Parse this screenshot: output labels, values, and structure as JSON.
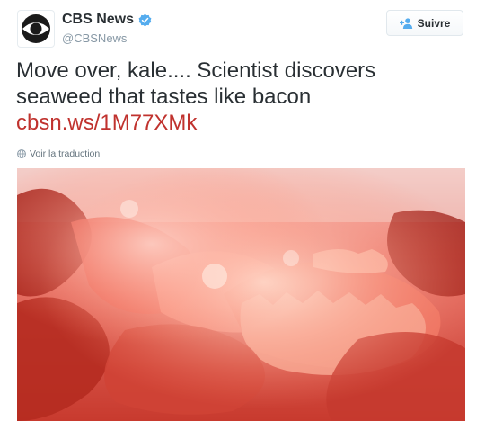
{
  "header": {
    "name": "CBS News",
    "handle": "@CBSNews",
    "follow_label": "Suivre"
  },
  "tweet": {
    "text": "Move over, kale.... Scientist discovers seaweed that tastes like bacon",
    "link": "cbsn.ws/1M77XMk"
  },
  "translate_label": "Voir la traduction",
  "colors": {
    "link": "#c0322e",
    "verified": "#55acee",
    "text": "#292f33",
    "secondary": "#8899a6"
  },
  "icons": {
    "avatar": "cbs-eye-logo",
    "verified": "verified-badge-icon",
    "follow": "add-user-icon",
    "translate": "globe-icon"
  }
}
